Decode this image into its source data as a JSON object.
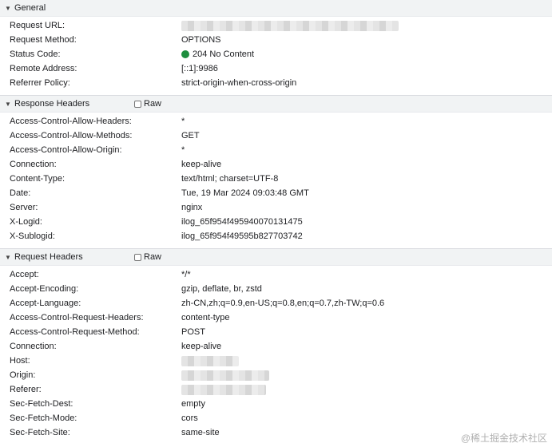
{
  "general": {
    "title": "General",
    "rows": [
      {
        "key": "Request URL:",
        "value": ""
      },
      {
        "key": "Request Method:",
        "value": "OPTIONS"
      },
      {
        "key": "Status Code:",
        "value": "204 No Content"
      },
      {
        "key": "Remote Address:",
        "value": "[::1]:9986"
      },
      {
        "key": "Referrer Policy:",
        "value": "strict-origin-when-cross-origin"
      }
    ]
  },
  "status_color": "#1e8e3e",
  "response_headers": {
    "title": "Response Headers",
    "raw_label": "Raw",
    "rows": [
      {
        "key": "Access-Control-Allow-Headers:",
        "value": "*"
      },
      {
        "key": "Access-Control-Allow-Methods:",
        "value": "GET"
      },
      {
        "key": "Access-Control-Allow-Origin:",
        "value": "*"
      },
      {
        "key": "Connection:",
        "value": "keep-alive"
      },
      {
        "key": "Content-Type:",
        "value": "text/html; charset=UTF-8"
      },
      {
        "key": "Date:",
        "value": "Tue, 19 Mar 2024 09:03:48 GMT"
      },
      {
        "key": "Server:",
        "value": "nginx"
      },
      {
        "key": "X-Logid:",
        "value": "ilog_65f954f495940070131475"
      },
      {
        "key": "X-Sublogid:",
        "value": "ilog_65f954f49595b827703742"
      }
    ]
  },
  "request_headers": {
    "title": "Request Headers",
    "raw_label": "Raw",
    "rows": [
      {
        "key": "Accept:",
        "value": "*/*"
      },
      {
        "key": "Accept-Encoding:",
        "value": "gzip, deflate, br, zstd"
      },
      {
        "key": "Accept-Language:",
        "value": "zh-CN,zh;q=0.9,en-US;q=0.8,en;q=0.7,zh-TW;q=0.6"
      },
      {
        "key": "Access-Control-Request-Headers:",
        "value": "content-type"
      },
      {
        "key": "Access-Control-Request-Method:",
        "value": "POST"
      },
      {
        "key": "Connection:",
        "value": "keep-alive"
      },
      {
        "key": "Host:",
        "value": ""
      },
      {
        "key": "Origin:",
        "value": ""
      },
      {
        "key": "Referer:",
        "value": ""
      },
      {
        "key": "Sec-Fetch-Dest:",
        "value": "empty"
      },
      {
        "key": "Sec-Fetch-Mode:",
        "value": "cors"
      },
      {
        "key": "Sec-Fetch-Site:",
        "value": "same-site"
      }
    ]
  },
  "watermark": "@稀土掘金技术社区"
}
